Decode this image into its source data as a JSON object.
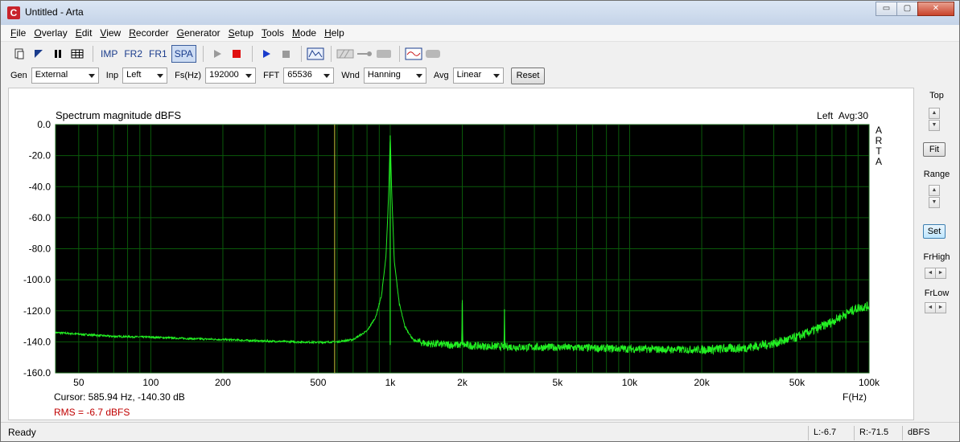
{
  "window": {
    "title": "Untitled - Arta",
    "app_icon": "C",
    "minimize": "▭",
    "maximize": "▢",
    "close": "✕"
  },
  "menu": {
    "items": [
      {
        "label": "File",
        "key": "F",
        "rest": "ile"
      },
      {
        "label": "Overlay",
        "key": "O",
        "rest": "verlay"
      },
      {
        "label": "Edit",
        "key": "E",
        "rest": "dit"
      },
      {
        "label": "View",
        "key": "V",
        "rest": "iew"
      },
      {
        "label": "Recorder",
        "key": "R",
        "rest": "ecorder"
      },
      {
        "label": "Generator",
        "key": "G",
        "rest": "enerator"
      },
      {
        "label": "Setup",
        "key": "S",
        "rest": "etup"
      },
      {
        "label": "Tools",
        "key": "T",
        "rest": "ools"
      },
      {
        "label": "Mode",
        "key": "M",
        "rest": "ode"
      },
      {
        "label": "Help",
        "key": "H",
        "rest": "elp"
      }
    ]
  },
  "toolbar": {
    "imp": "IMP",
    "fr2": "FR2",
    "fr1": "FR1",
    "spa": "SPA"
  },
  "controls": {
    "gen_label": "Gen",
    "gen_value": "External",
    "inp_label": "Inp",
    "inp_value": "Left",
    "fs_label": "Fs(Hz)",
    "fs_value": "192000",
    "fft_label": "FFT",
    "fft_value": "65536",
    "wnd_label": "Wnd",
    "wnd_value": "Hanning",
    "avg_label": "Avg",
    "avg_value": "Linear",
    "reset_label": "Reset"
  },
  "plot": {
    "title": "Spectrum magnitude dBFS",
    "channel": "Left",
    "avg": "Avg:30",
    "logo": [
      "A",
      "R",
      "T",
      "A"
    ],
    "cursor_text": "Cursor: 585.94 Hz, -140.30 dB",
    "rms_text": "RMS =    -6.7 dBFS",
    "x_unit_label": "F(Hz)"
  },
  "chart_data": {
    "type": "line",
    "title": "Spectrum magnitude dBFS",
    "xlabel": "F(Hz)",
    "ylabel": "",
    "x_scale": "log",
    "xlim": [
      40,
      100000
    ],
    "ylim": [
      -160,
      0
    ],
    "grid": true,
    "x_ticks": [
      {
        "value": 50,
        "label": "50"
      },
      {
        "value": 100,
        "label": "100"
      },
      {
        "value": 200,
        "label": "200"
      },
      {
        "value": 500,
        "label": "500"
      },
      {
        "value": 1000,
        "label": "1k"
      },
      {
        "value": 2000,
        "label": "2k"
      },
      {
        "value": 5000,
        "label": "5k"
      },
      {
        "value": 10000,
        "label": "10k"
      },
      {
        "value": 20000,
        "label": "20k"
      },
      {
        "value": 50000,
        "label": "50k"
      },
      {
        "value": 100000,
        "label": "100k"
      }
    ],
    "y_ticks": [
      {
        "value": 0,
        "label": "0.0"
      },
      {
        "value": -20,
        "label": "-20.0"
      },
      {
        "value": -40,
        "label": "-40.0"
      },
      {
        "value": -60,
        "label": "-60.0"
      },
      {
        "value": -80,
        "label": "-80.0"
      },
      {
        "value": -100,
        "label": "-100.0"
      },
      {
        "value": -120,
        "label": "-120.0"
      },
      {
        "value": -140,
        "label": "-140.0"
      },
      {
        "value": -160,
        "label": "-160.0"
      }
    ],
    "cursor_x": 585.94,
    "series": [
      {
        "color": "#22ee22",
        "x": [
          40,
          50,
          70,
          100,
          150,
          200,
          300,
          400,
          500,
          600,
          700,
          800,
          870,
          920,
          960,
          985,
          1000,
          1015,
          1040,
          1090,
          1150,
          1250,
          1400,
          1600,
          1800,
          1990,
          2000,
          2010,
          2200,
          2600,
          2990,
          3000,
          3010,
          3500,
          4000,
          5000,
          7000,
          10000,
          15000,
          20000,
          30000,
          40000,
          50000,
          60000,
          70000,
          80000,
          90000,
          100000
        ],
        "y": [
          -134,
          -135,
          -136.5,
          -137,
          -138,
          -138.5,
          -139.5,
          -140,
          -140.3,
          -140,
          -138.5,
          -133,
          -124,
          -110,
          -85,
          -45,
          -7,
          -45,
          -88,
          -115,
          -130,
          -139,
          -141,
          -141.5,
          -142,
          -142,
          -115,
          -142,
          -142.5,
          -143,
          -143,
          -119,
          -143,
          -143.5,
          -143.5,
          -143.5,
          -144,
          -144.5,
          -145,
          -145,
          -144,
          -141,
          -137,
          -132,
          -127,
          -122,
          -118,
          -117
        ]
      }
    ]
  },
  "sidepanel": {
    "top_label": "Top",
    "fit_label": "Fit",
    "range_label": "Range",
    "set_label": "Set",
    "frhigh_label": "FrHigh",
    "frlow_label": "FrLow",
    "up": "▲",
    "down": "▼",
    "left": "◄",
    "right": "►"
  },
  "status": {
    "ready": "Ready",
    "l_value": "L:-6.7",
    "r_value": "R:-71.5",
    "unit": "dBFS"
  },
  "colors": {
    "plot_bg": "#000000",
    "grid": "#0a5a0a",
    "trace": "#22ee22",
    "cursor": "#c8c83a",
    "rms": "#c00000"
  }
}
